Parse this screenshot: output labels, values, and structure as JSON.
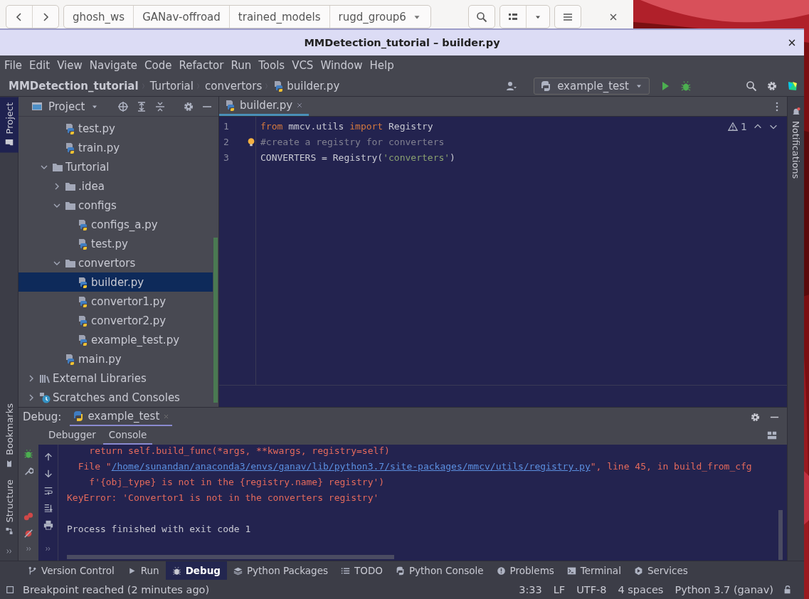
{
  "file_manager": {
    "path": [
      "ghosh_ws",
      "GANav-offroad",
      "trained_models",
      "rugd_group6"
    ]
  },
  "window": {
    "title": "MMDetection_tutorial – builder.py"
  },
  "menu": [
    "File",
    "Edit",
    "View",
    "Navigate",
    "Code",
    "Refactor",
    "Run",
    "Tools",
    "VCS",
    "Window",
    "Help"
  ],
  "breadcrumb": [
    "MMDetection_tutorial",
    "Turtorial",
    "convertors",
    "builder.py"
  ],
  "run_config": "example_test",
  "side_tabs": [
    {
      "label": "Project",
      "selected": true
    },
    {
      "label": "Bookmarks",
      "selected": false
    },
    {
      "label": "Structure",
      "selected": false
    }
  ],
  "project": {
    "title": "Project",
    "tree": [
      {
        "kind": "continued",
        "children": [
          {
            "kind": "continued",
            "children": [
              {
                "kind": "file",
                "name": "test.py",
                "selected": false
              },
              {
                "kind": "file",
                "name": "train.py",
                "selected": false
              }
            ]
          },
          {
            "kind": "folder",
            "name": "Turtorial",
            "expanded": true,
            "selected": false,
            "children": [
              {
                "kind": "folder",
                "name": ".idea",
                "expanded": false,
                "selected": false
              },
              {
                "kind": "folder",
                "name": "configs",
                "expanded": true,
                "selected": false,
                "children": [
                  {
                    "kind": "file",
                    "name": "configs_a.py",
                    "selected": false
                  },
                  {
                    "kind": "file",
                    "name": "test.py",
                    "selected": false
                  }
                ]
              },
              {
                "kind": "folder",
                "name": "convertors",
                "expanded": true,
                "selected": false,
                "children": [
                  {
                    "kind": "file",
                    "name": "builder.py",
                    "selected": true
                  },
                  {
                    "kind": "file",
                    "name": "convertor1.py",
                    "selected": false
                  },
                  {
                    "kind": "file",
                    "name": "convertor2.py",
                    "selected": false
                  },
                  {
                    "kind": "file",
                    "name": "example_test.py",
                    "selected": false
                  }
                ]
              },
              {
                "kind": "file",
                "name": "main.py",
                "selected": false
              }
            ]
          }
        ]
      },
      {
        "kind": "library",
        "name": "External Libraries",
        "expanded": false,
        "selected": false
      },
      {
        "kind": "scratches",
        "name": "Scratches and Consoles",
        "expanded": false,
        "selected": false
      }
    ]
  },
  "editor": {
    "tabs": [
      {
        "label": "builder.py",
        "selected": true
      }
    ],
    "inspection": "1",
    "lines": [
      {
        "number": "1",
        "tokens": [
          {
            "kind": "keyword",
            "text": "from"
          },
          {
            "kind": "plain",
            "text": " mmcv.utils "
          },
          {
            "kind": "keyword",
            "text": "import"
          },
          {
            "kind": "plain",
            "text": " Registry"
          }
        ]
      },
      {
        "number": "2",
        "tokens": [
          {
            "kind": "comment",
            "text": "#create a registry for converters"
          }
        ]
      },
      {
        "number": "3",
        "tokens": [
          {
            "kind": "plain",
            "text": "CONVERTERS = Registry("
          },
          {
            "kind": "string",
            "text": "'converters'"
          },
          {
            "kind": "plain",
            "text": ")"
          }
        ]
      }
    ]
  },
  "notifications": {
    "label": "Notifications"
  },
  "debug": {
    "title": "Debug:",
    "tabs": [
      {
        "label": "example_test",
        "selected": true
      }
    ],
    "subtabs": [
      {
        "label": "Debugger",
        "selected": false
      },
      {
        "label": "Console",
        "selected": true
      }
    ],
    "console": [
      {
        "segments": [
          {
            "kind": "error",
            "text": "    return self.build_func(*args, **kwargs, registry=self)"
          }
        ]
      },
      {
        "segments": [
          {
            "kind": "error",
            "text": "  File \""
          },
          {
            "kind": "link",
            "text": "/home/sunandan/anaconda3/envs/ganav/lib/python3.7/site-packages/mmcv/utils/registry.py"
          },
          {
            "kind": "error",
            "text": "\", line 45, in build_from_cfg"
          }
        ]
      },
      {
        "segments": [
          {
            "kind": "error",
            "text": "    f'{obj_type} is not in the {registry.name} registry')"
          }
        ]
      },
      {
        "segments": [
          {
            "kind": "error",
            "text": "KeyError: 'Convertor1 is not in the converters registry'"
          }
        ]
      },
      {
        "kind": "summary",
        "segments": [
          {
            "kind": "normal",
            "text": "Process finished with exit code 1"
          }
        ]
      }
    ]
  },
  "tool_windows": [
    {
      "label": "Version Control",
      "selected": false
    },
    {
      "label": "Run",
      "selected": false
    },
    {
      "label": "Debug",
      "selected": true
    },
    {
      "label": "Python Packages",
      "selected": false
    },
    {
      "label": "TODO",
      "selected": false
    },
    {
      "label": "Python Console",
      "selected": false
    },
    {
      "label": "Problems",
      "selected": false
    },
    {
      "label": "Terminal",
      "selected": false
    },
    {
      "label": "Services",
      "selected": false
    }
  ],
  "status_bar": {
    "message": "Breakpoint reached (2 minutes ago)",
    "items": [
      "3:33",
      "LF",
      "UTF-8",
      "4 spaces",
      "Python 3.7 (ganav)"
    ]
  }
}
